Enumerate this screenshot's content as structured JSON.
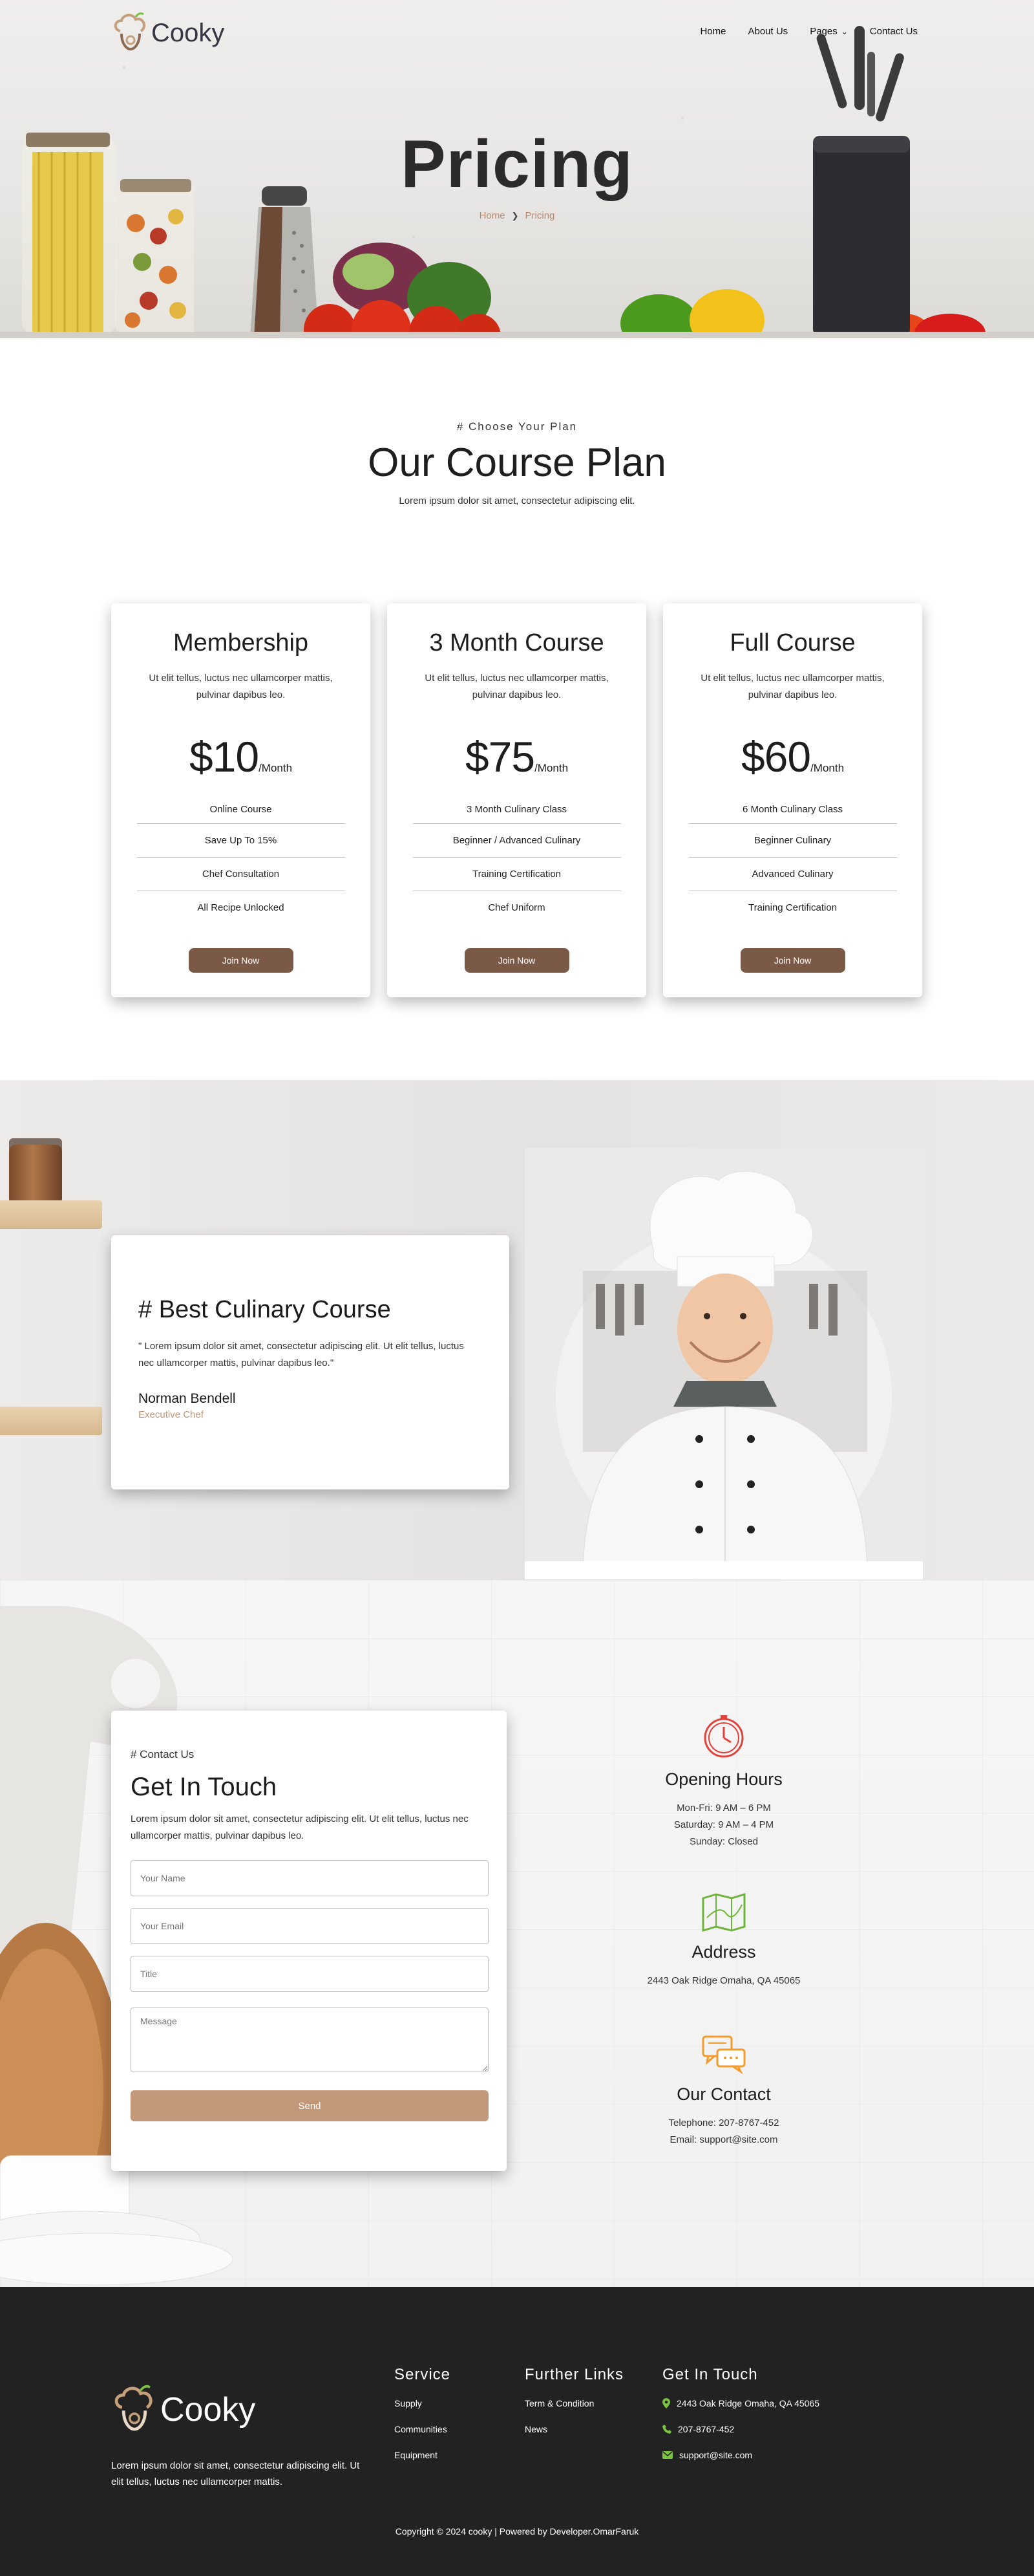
{
  "brand": {
    "name": "Cooky"
  },
  "nav": {
    "items": [
      "Home",
      "About Us",
      "Pages",
      "Contact Us"
    ]
  },
  "hero": {
    "title": "Pricing",
    "breadcrumb": {
      "home": "Home",
      "current": "Pricing"
    }
  },
  "plans": {
    "eyebrow": "# Choose Your Plan",
    "title": "Our Course Plan",
    "subtitle": "Lorem ipsum dolor sit amet, consectetur adipiscing elit.",
    "cards": [
      {
        "name": "Membership",
        "desc": "Ut elit tellus, luctus nec ullamcorper mattis, pulvinar dapibus leo.",
        "price": "$10",
        "per": "/Month",
        "features": [
          "Online Course",
          "Save Up To 15%",
          "Chef Consultation",
          "All Recipe Unlocked"
        ],
        "cta": "Join Now"
      },
      {
        "name": "3 Month Course",
        "desc": "Ut elit tellus, luctus nec ullamcorper mattis, pulvinar dapibus leo.",
        "price": "$75",
        "per": "/Month",
        "features": [
          "3 Month Culinary Class",
          "Beginner / Advanced Culinary",
          "Training Certification",
          "Chef Uniform"
        ],
        "cta": "Join Now"
      },
      {
        "name": "Full Course",
        "desc": "Ut elit tellus, luctus nec ullamcorper mattis, pulvinar dapibus leo.",
        "price": "$60",
        "per": "/Month",
        "features": [
          "6 Month Culinary Class",
          "Beginner Culinary",
          "Advanced Culinary",
          "Training Certification"
        ],
        "cta": "Join Now"
      }
    ]
  },
  "culinary": {
    "title": "# Best Culinary Course",
    "quote": "\" Lorem ipsum dolor sit amet, consectetur adipiscing elit. Ut elit tellus, luctus nec ullamcorper mattis, pulvinar dapibus leo.\"",
    "name": "Norman Bendell",
    "role": "Executive Chef"
  },
  "contact": {
    "eyebrow": "# Contact Us",
    "title": "Get In Touch",
    "desc": "Lorem ipsum dolor sit amet, consectetur adipiscing elit. Ut elit tellus, luctus nec ullamcorper mattis, pulvinar dapibus leo.",
    "placeholders": {
      "name": "Your Name",
      "email": "Your Email",
      "title": "Title",
      "message": "Message"
    },
    "send": "Send",
    "hours": {
      "title": "Opening Hours",
      "lines": [
        "Mon-Fri: 9 AM – 6 PM",
        "Saturday: 9 AM – 4 PM",
        "Sunday: Closed"
      ]
    },
    "address": {
      "title": "Address",
      "lines": [
        "2443 Oak Ridge Omaha, QA 45065"
      ]
    },
    "our_contact": {
      "title": "Our Contact",
      "lines": [
        "Telephone: 207-8767-452",
        "Email: support@site.com"
      ]
    }
  },
  "footer": {
    "desc": "Lorem ipsum dolor sit amet, consectetur adipiscing elit. Ut elit tellus, luctus nec ullamcorper mattis.",
    "service": {
      "title": "Service",
      "links": [
        "Supply",
        "Communities",
        "Equipment"
      ]
    },
    "further": {
      "title": "Further Links",
      "links": [
        "Term & Condition",
        "News"
      ]
    },
    "touch": {
      "title": "Get In Touch",
      "items": [
        "2443 Oak Ridge Omaha, QA 45065",
        "207-8767-452",
        "support@site.com"
      ]
    },
    "copyright": "Copyright © 2024 cooky | Powered by Developer.OmarFaruk"
  },
  "colors": {
    "accent": "#c29879",
    "button_dark": "#7a5a47",
    "role": "#c09575",
    "footer_bg": "#222222"
  },
  "icons": [
    "cooky-logo-icon",
    "chevron-down-icon",
    "chevron-right-icon",
    "clock-icon",
    "map-icon",
    "chat-icon",
    "map-pin-icon",
    "phone-icon",
    "mail-icon"
  ]
}
